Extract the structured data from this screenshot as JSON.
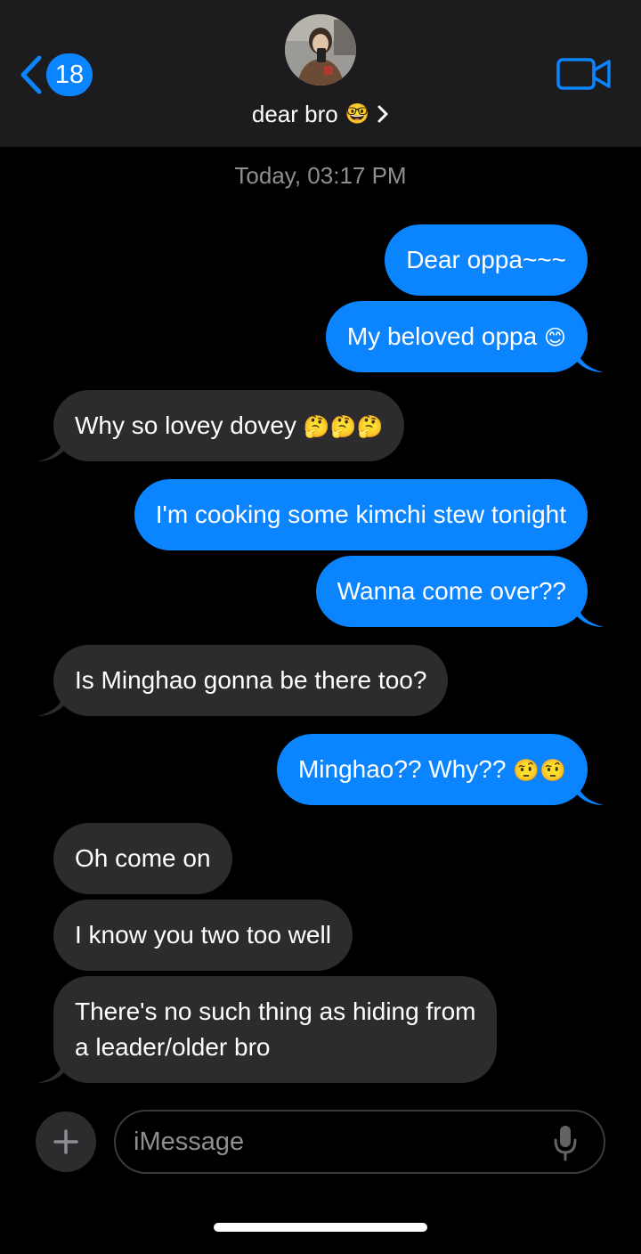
{
  "header": {
    "back_count": "18",
    "contact_name": "dear bro",
    "contact_emoji": "🤓"
  },
  "thread": {
    "timestamp": "Today, 03:17 PM",
    "messages": [
      {
        "from": "me",
        "text": "Dear oppa~~~"
      },
      {
        "from": "me",
        "text": "My beloved oppa",
        "emoji": "😊"
      },
      {
        "from": "them",
        "text": "Why so lovey dovey",
        "emoji": "🤔🤔🤔"
      },
      {
        "from": "me",
        "text": "I'm cooking some kimchi stew tonight"
      },
      {
        "from": "me",
        "text": "Wanna come over??"
      },
      {
        "from": "them",
        "text": "Is Minghao gonna be there too?"
      },
      {
        "from": "me",
        "text": "Minghao?? Why??",
        "emoji": "🤨🤨"
      },
      {
        "from": "them",
        "text": "Oh come on"
      },
      {
        "from": "them",
        "text": "I know you two too well"
      },
      {
        "from": "them",
        "line1": "There's no such thing as hiding from",
        "line2": "a leader/older bro"
      }
    ]
  },
  "composer": {
    "placeholder": "iMessage"
  },
  "colors": {
    "sent_bubble": "#0a84ff",
    "received_bubble": "#2c2c2e",
    "header_bg": "#1c1c1e",
    "background": "#000000"
  }
}
